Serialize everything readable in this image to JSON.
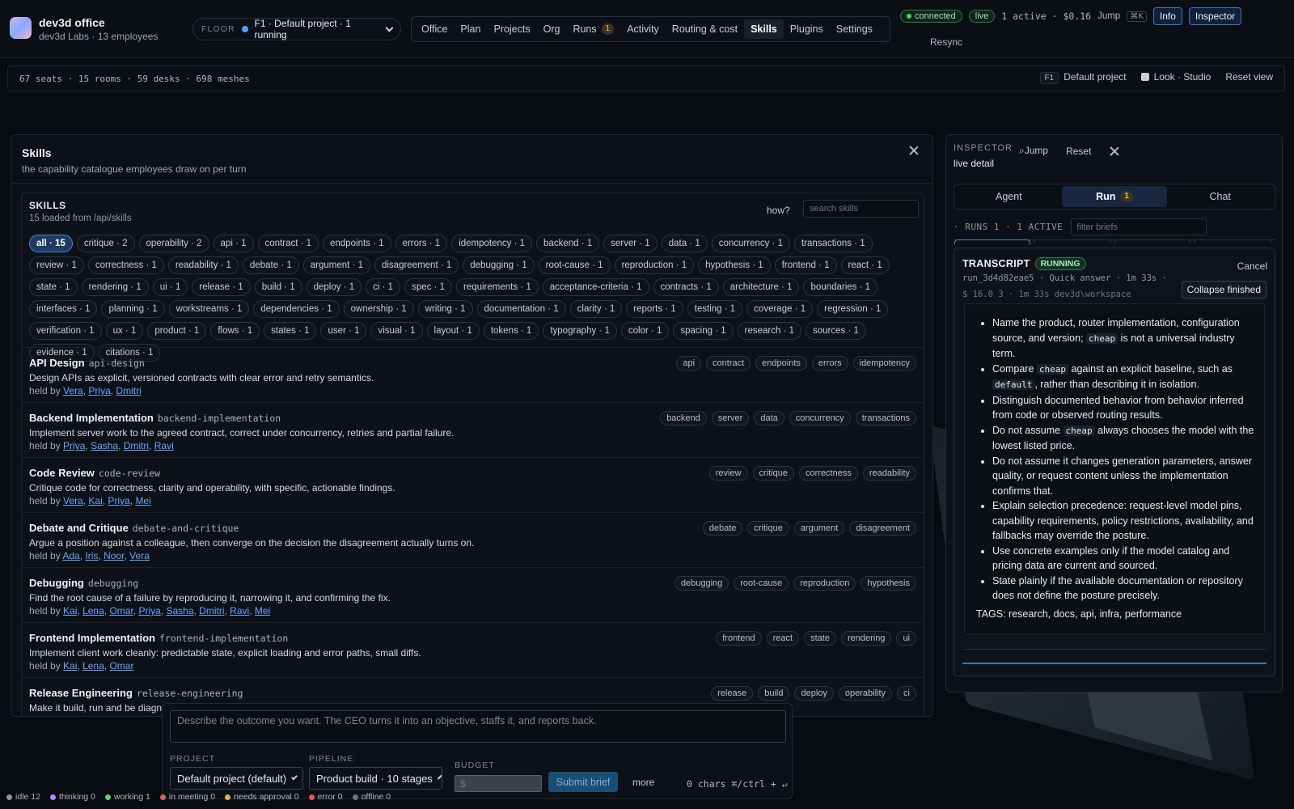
{
  "brand": {
    "title": "dev3d office",
    "subtitle": "dev3d Labs · 13 employees"
  },
  "floor": {
    "label": "FLOOR",
    "value": "F1 · Default project · 1 running"
  },
  "nav": [
    {
      "label": "Office"
    },
    {
      "label": "Plan"
    },
    {
      "label": "Projects"
    },
    {
      "label": "Org"
    },
    {
      "label": "Runs",
      "badge": "1"
    },
    {
      "label": "Activity"
    },
    {
      "label": "Routing & cost"
    },
    {
      "label": "Skills",
      "active": true
    },
    {
      "label": "Plugins"
    },
    {
      "label": "Settings"
    }
  ],
  "status": {
    "connected": "connected",
    "live": "live",
    "summary": "1 active · $0.16",
    "jump": "Jump",
    "jump_kbd": "⌘K",
    "info": "Info",
    "inspector": "Inspector",
    "resync": "Resync"
  },
  "secondbar": {
    "stats": "67 seats · 15 rooms · 59 desks · 698 meshes",
    "floor_tag": "F1",
    "project": "Default project",
    "look": "Look · Studio",
    "reset": "Reset view"
  },
  "skills_panel": {
    "title": "Skills",
    "subtitle": "the capability catalogue employees draw on per turn",
    "inner_title": "SKILLS",
    "inner_sub": "15 loaded from /api/skills",
    "how": "how?",
    "search_placeholder": "search skills",
    "chips": [
      "all · 15",
      "critique · 2",
      "operability · 2",
      "api · 1",
      "contract · 1",
      "endpoints · 1",
      "errors · 1",
      "idempotency · 1",
      "backend · 1",
      "server · 1",
      "data · 1",
      "concurrency · 1",
      "transactions · 1",
      "review · 1",
      "correctness · 1",
      "readability · 1",
      "debate · 1",
      "argument · 1",
      "disagreement · 1",
      "debugging · 1",
      "root-cause · 1",
      "reproduction · 1",
      "hypothesis · 1",
      "frontend · 1",
      "react · 1",
      "state · 1",
      "rendering · 1",
      "ui · 1",
      "release · 1",
      "build · 1",
      "deploy · 1",
      "ci · 1",
      "spec · 1",
      "requirements · 1",
      "acceptance-criteria · 1",
      "contracts · 1",
      "architecture · 1",
      "boundaries · 1",
      "interfaces · 1",
      "planning · 1",
      "workstreams · 1",
      "dependencies · 1",
      "ownership · 1",
      "writing · 1",
      "documentation · 1",
      "clarity · 1",
      "reports · 1",
      "testing · 1",
      "coverage · 1",
      "regression · 1",
      "verification · 1",
      "ux · 1",
      "product · 1",
      "flows · 1",
      "states · 1",
      "user · 1",
      "visual · 1",
      "layout · 1",
      "tokens · 1",
      "typography · 1",
      "color · 1",
      "spacing · 1",
      "research · 1",
      "sources · 1",
      "evidence · 1",
      "citations · 1"
    ],
    "skills": [
      {
        "name": "API Design",
        "slug": "api-design",
        "desc": "Design APIs as explicit, versioned contracts with clear error and retry semantics.",
        "held_label": "held by",
        "holders": [
          "Vera",
          "Priya",
          "Dmitri"
        ],
        "tags": [
          "api",
          "contract",
          "endpoints",
          "errors",
          "idempotency"
        ]
      },
      {
        "name": "Backend Implementation",
        "slug": "backend-implementation",
        "desc": "Implement server work to the agreed contract, correct under concurrency, retries and partial failure.",
        "held_label": "held by",
        "holders": [
          "Priya",
          "Sasha",
          "Dmitri",
          "Ravi"
        ],
        "tags": [
          "backend",
          "server",
          "data",
          "concurrency",
          "transactions"
        ]
      },
      {
        "name": "Code Review",
        "slug": "code-review",
        "desc": "Critique code for correctness, clarity and operability, with specific, actionable findings.",
        "held_label": "held by",
        "holders": [
          "Vera",
          "Kai",
          "Priya",
          "Mei"
        ],
        "tags": [
          "review",
          "critique",
          "correctness",
          "readability"
        ]
      },
      {
        "name": "Debate and Critique",
        "slug": "debate-and-critique",
        "desc": "Argue a position against a colleague, then converge on the decision the disagreement actually turns on.",
        "held_label": "held by",
        "holders": [
          "Ada",
          "Iris",
          "Noor",
          "Vera"
        ],
        "tags": [
          "debate",
          "critique",
          "argument",
          "disagreement"
        ]
      },
      {
        "name": "Debugging",
        "slug": "debugging",
        "desc": "Find the root cause of a failure by reproducing it, narrowing it, and confirming the fix.",
        "held_label": "held by",
        "holders": [
          "Kai",
          "Lena",
          "Omar",
          "Priya",
          "Sasha",
          "Dmitri",
          "Ravi",
          "Mei"
        ],
        "tags": [
          "debugging",
          "root-cause",
          "reproduction",
          "hypothesis"
        ]
      },
      {
        "name": "Frontend Implementation",
        "slug": "frontend-implementation",
        "desc": "Implement client work cleanly: predictable state, explicit loading and error paths, small diffs.",
        "held_label": "held by",
        "holders": [
          "Kai",
          "Lena",
          "Omar"
        ],
        "tags": [
          "frontend",
          "react",
          "state",
          "rendering",
          "ui"
        ]
      },
      {
        "name": "Release Engineering",
        "slug": "release-engineering",
        "desc": "Make it build, run and be diagnosable",
        "held_label": "held by",
        "holders": [],
        "tags": [
          "release",
          "build",
          "deploy",
          "operability",
          "ci"
        ]
      }
    ]
  },
  "inspector": {
    "label": "INSPECTOR",
    "sub": "live detail",
    "jump": "Jump",
    "reset": "Reset",
    "tabs": [
      {
        "label": "Agent"
      },
      {
        "label": "Run",
        "badge": "1",
        "active": true
      },
      {
        "label": "Chat"
      }
    ],
    "runs_label": "· RUNS 1 · 1 ACTIVE",
    "filter_placeholder": "filter briefs",
    "transcript": {
      "title": "TRANSCRIPT",
      "state": "RUNNING",
      "cancel": "Cancel",
      "meta": "run_3d4d82eae5 · Quick answer · 1m 33s ·",
      "path": "$ 16.0 3 · 1m 33s dev3d\\workspace",
      "collapse": "Collapse finished",
      "tags_line": "TAGS: research, docs, api, infra, performance"
    }
  },
  "composer": {
    "placeholder": "Describe the outcome you want. The CEO turns it into an objective, staffs it, and reports back.",
    "project_label": "PROJECT",
    "project_value": "Default project (default)",
    "pipeline_label": "PIPELINE",
    "pipeline_value": "Product build · 10 stages",
    "budget_label": "BUDGET",
    "budget_placeholder": "$",
    "submit": "Submit brief",
    "more": "more",
    "chars": "0 chars ⌘/ctrl + ↵"
  },
  "footer": [
    {
      "label": "idle 12",
      "color": "#8d97a3"
    },
    {
      "label": "thinking 0",
      "color": "#b58cff"
    },
    {
      "label": "working 1",
      "color": "#5fd07f"
    },
    {
      "label": "in meeting 0",
      "color": "#e0616b"
    },
    {
      "label": "needs approval 0",
      "color": "#e8b04a"
    },
    {
      "label": "error 0",
      "color": "#e05a5a"
    },
    {
      "label": "offline 0",
      "color": "#6d7783"
    }
  ]
}
